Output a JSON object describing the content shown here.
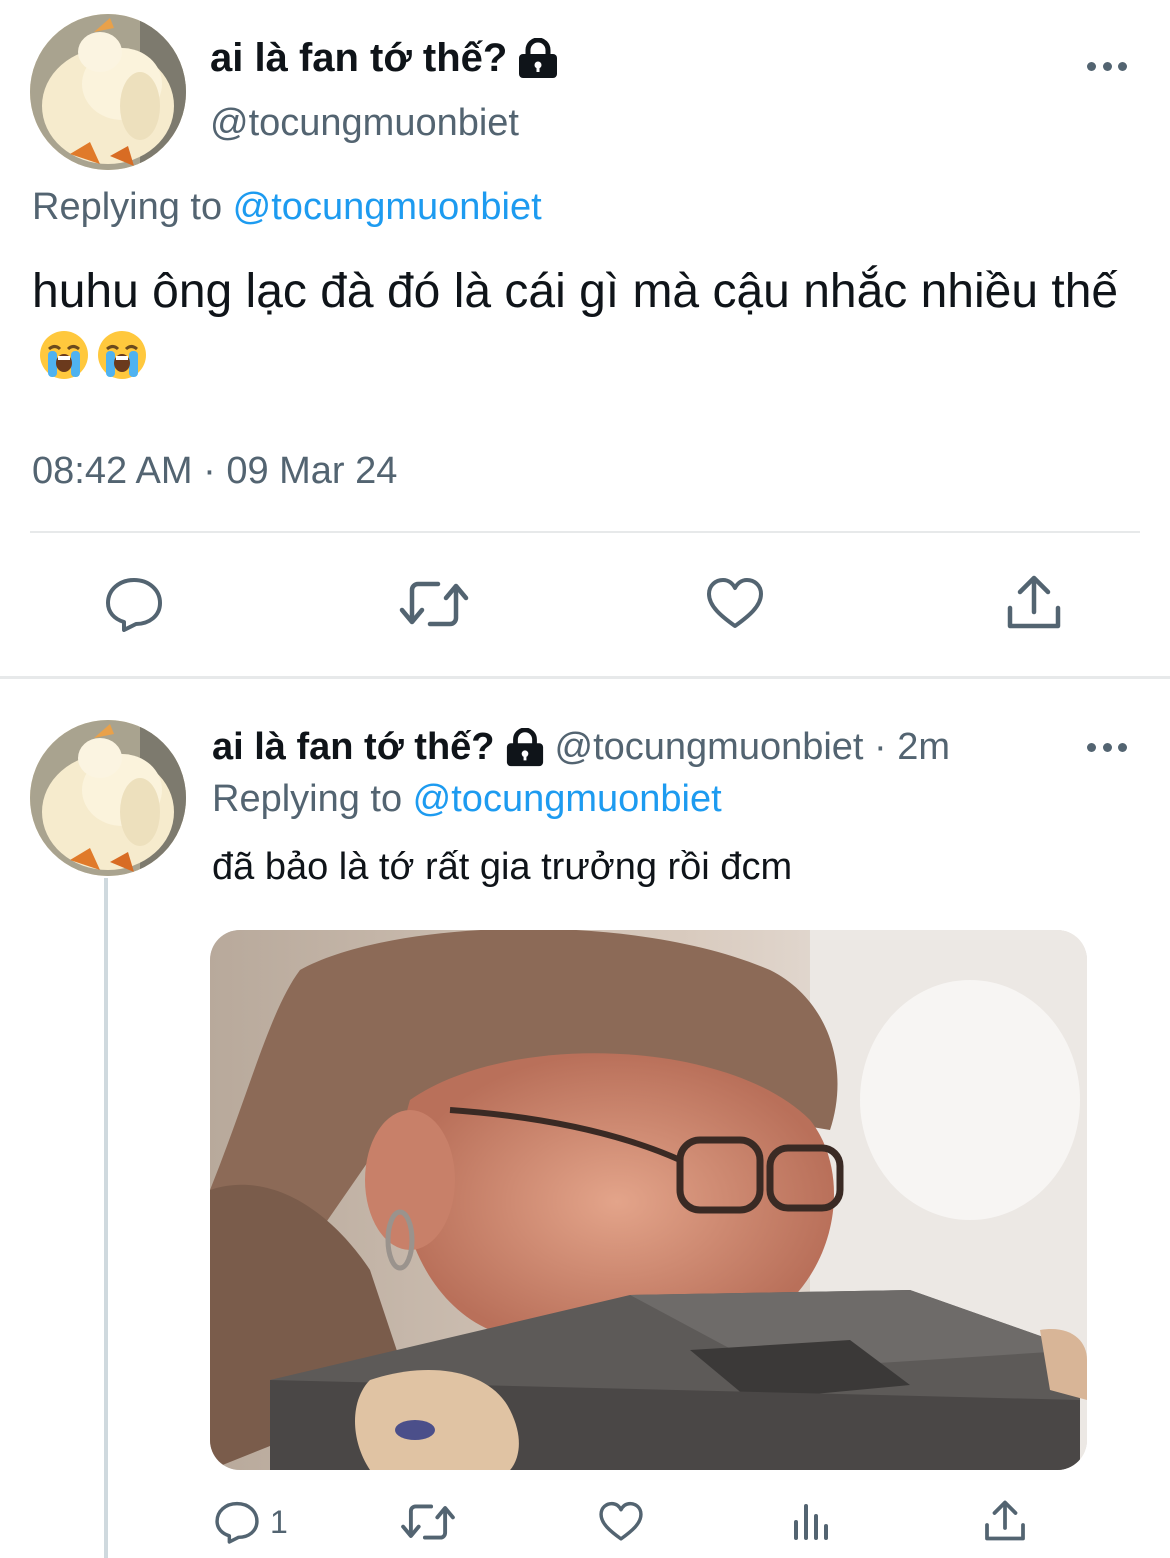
{
  "main_tweet": {
    "avatar": "duck-avatar",
    "display_name": "ai là fan tớ thế?",
    "protected_icon": "lock-icon",
    "handle": "@tocungmuonbiet",
    "replying_prefix": "Replying to ",
    "replying_handle": "@tocungmuonbiet",
    "text": "huhu ông lạc đà đó là cái gì mà cậu nhắc nhiều thế",
    "emojis": [
      "loudly-crying-face",
      "loudly-crying-face"
    ],
    "timestamp": "08:42 AM · 09 Mar 24",
    "actions": [
      "reply-icon",
      "retweet-icon",
      "like-icon",
      "share-icon"
    ]
  },
  "reply_tweet": {
    "avatar": "duck-avatar",
    "display_name": "ai là fan tớ thế?",
    "protected_icon": "lock-icon",
    "meta": "@tocungmuonbiet · 2m",
    "replying_prefix": "Replying to ",
    "replying_handle": "@tocungmuonbiet",
    "text": "đã bảo là tớ rất gia trưởng rồi đcm",
    "media": "woman-biting-laptop-image",
    "reply_count": "1",
    "actions": [
      "reply-icon",
      "retweet-icon",
      "like-icon",
      "views-icon",
      "share-icon"
    ]
  },
  "colors": {
    "text": "#0f1419",
    "secondary": "#536471",
    "link": "#1d9bf0",
    "divider": "#e7e9ea"
  }
}
